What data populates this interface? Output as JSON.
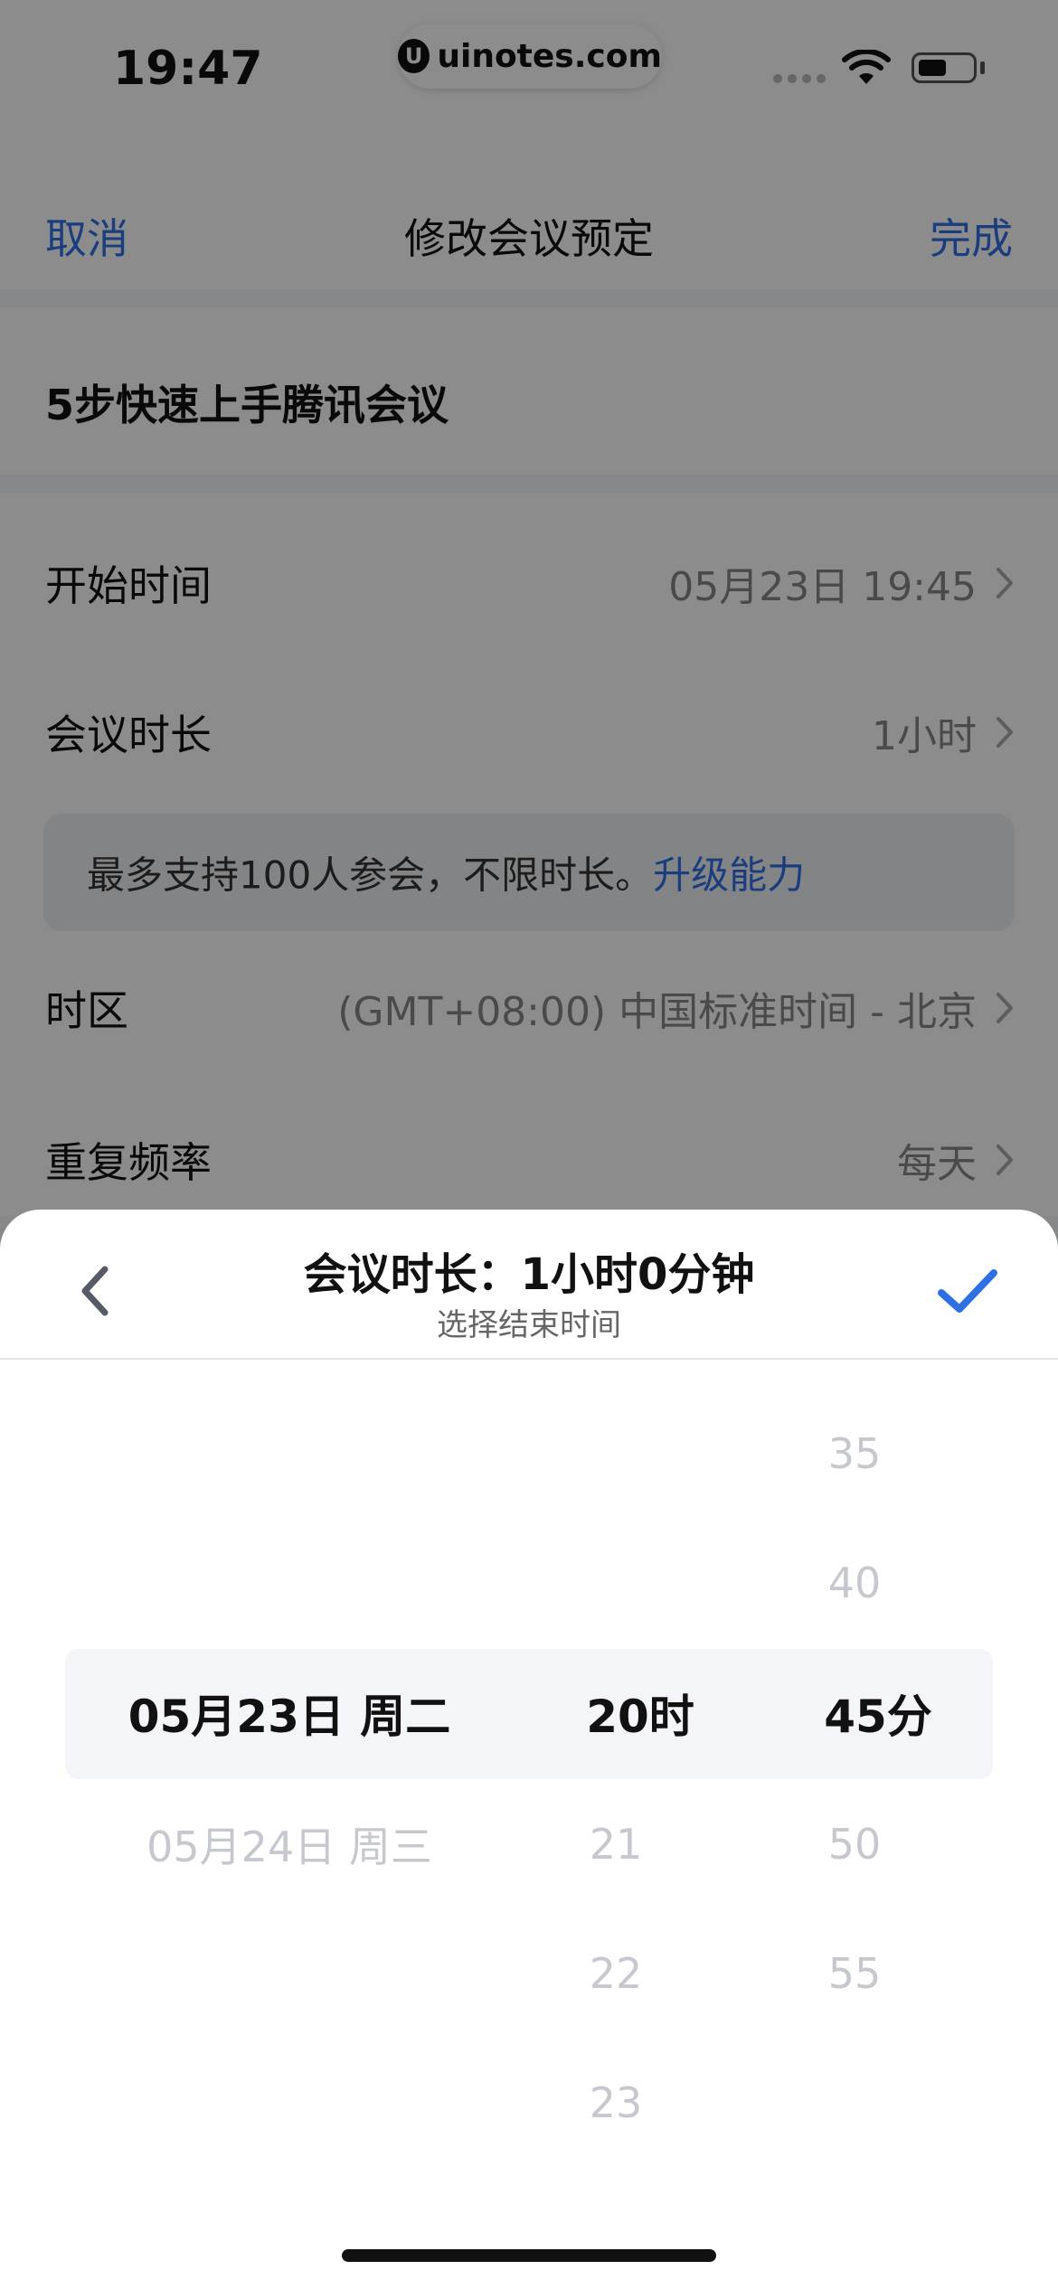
{
  "status_bar": {
    "time": "19:47",
    "watermark": "uinotes.com",
    "watermark_logo": "U"
  },
  "nav": {
    "cancel": "取消",
    "title": "修改会议预定",
    "done": "完成"
  },
  "meeting": {
    "title": "5步快速上手腾讯会议"
  },
  "settings": {
    "start_time": {
      "label": "开始时间",
      "value": "05月23日 19:45"
    },
    "duration": {
      "label": "会议时长",
      "value": "1小时"
    },
    "info": {
      "text": "最多支持100人参会，不限时长。",
      "link": "升级能力"
    },
    "timezone": {
      "label": "时区",
      "value": "(GMT+08:00) 中国标准时间 - 北京"
    },
    "repeat": {
      "label": "重复频率",
      "value": "每天"
    }
  },
  "sheet": {
    "title": "会议时长：1小时0分钟",
    "subtitle": "选择结束时间",
    "picker": {
      "date": {
        "selected": "05月23日 周二",
        "next1": "05月24日 周三"
      },
      "hour": {
        "selected": "20时",
        "next1": "21",
        "next2": "22",
        "next3": "23"
      },
      "minute": {
        "prev2": "35",
        "prev1": "40",
        "selected": "45分",
        "next1": "50",
        "next2": "55"
      }
    }
  },
  "colors": {
    "accent": "#2f6fe4",
    "text": "#111111",
    "muted": "#888888",
    "overlay": "rgba(0,0,0,0.45)"
  },
  "icons": [
    "chevron-right-icon",
    "back-chevron-icon",
    "checkmark-icon",
    "wifi-icon",
    "battery-icon"
  ]
}
